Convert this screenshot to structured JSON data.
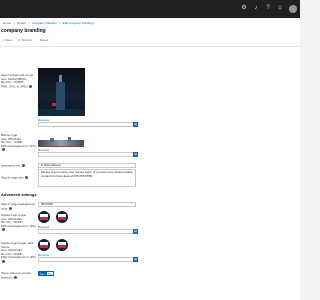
{
  "breadcrumb": [
    "Home",
    "Tenant",
    "Company branding",
    "Edit company branding"
  ],
  "page": {
    "title": "company branding"
  },
  "commands": [
    {
      "label": "Save",
      "icon": "save-icon"
    },
    {
      "label": "Discard",
      "icon": "discard-icon"
    },
    {
      "label": "Delete",
      "icon": "delete-icon"
    }
  ],
  "fields": {
    "bg_image": {
      "label": "page background image\nsize: 1920x1080px\nfile size: <300KB\nPNG, JPG, or JPEG",
      "remove": "Remove",
      "file_value": "Select a file"
    },
    "banner": {
      "label": "Banner logo\nsize: 280x60px\nfile size: <10KB\nPNG (transparent) or JPG",
      "remove": "Remove",
      "file_value": "Select a file"
    },
    "username_hint": {
      "label": "Username hint",
      "value": "E.Mail Address"
    },
    "signin_text": {
      "label": "Sign-in page text",
      "value": "Please sign in using your secure login. If you have any issues please contact the help desk at 555-555-5555."
    }
  },
  "advanced": {
    "title": "Advanced settings",
    "bg_color": {
      "label": "Sign-in page background color",
      "value": "#FF0000"
    },
    "square_logo": {
      "label": "Square logo image\nsize: 240x240px\nfile size: <50KB\nPNG (transparent) or JPG",
      "remove": "Remove",
      "file_value": "Select a file"
    },
    "square_logo_dark": {
      "label": "Square logo image, dark theme\nsize: 240x240px\nfile size: <50KB\nPNG (transparent) or JPG",
      "remove": "Remove",
      "file_value": "Select a file"
    },
    "stay_signed_in": {
      "label": "Show option to remain signed in",
      "options": [
        "Yes",
        "No"
      ],
      "selected": "Yes"
    }
  },
  "colors": {
    "accent": "#0067b8",
    "topbar": "#202020"
  },
  "topbar": {
    "icons": [
      "settings-icon",
      "notifications-icon",
      "help-icon",
      "feedback-icon",
      "account-icon"
    ]
  }
}
